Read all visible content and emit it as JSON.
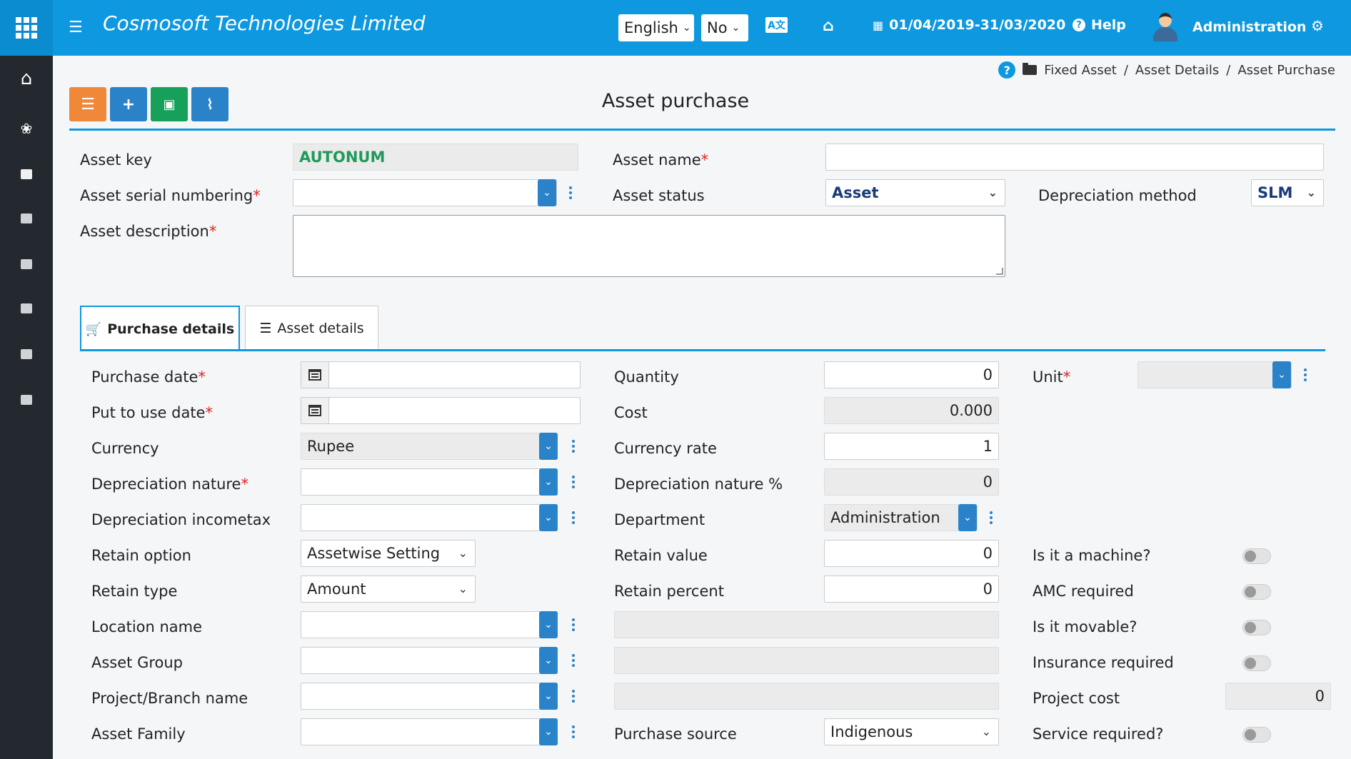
{
  "header": {
    "company": "Cosmosoft Technologies Limited",
    "language": "English",
    "no_select": "No",
    "translate_icon": "translate-icon",
    "period": "01/04/2019-31/03/2020",
    "help": "Help",
    "user": "Administration"
  },
  "breadcrumb": {
    "items": [
      "Fixed Asset",
      "Asset Details",
      "Asset Purchase"
    ]
  },
  "page": {
    "title": "Asset purchase"
  },
  "form": {
    "asset_key_label": "Asset key",
    "asset_key_value": "AUTONUM",
    "asset_name_label": "Asset name",
    "asset_serial_label": "Asset serial numbering",
    "asset_status_label": "Asset status",
    "asset_status_value": "Asset",
    "dep_method_label": "Depreciation method",
    "dep_method_value": "SLM",
    "asset_desc_label": "Asset description"
  },
  "tabs": {
    "purchase": "Purchase details",
    "asset": "Asset details"
  },
  "purchase": {
    "purchase_date": "Purchase date",
    "put_to_use_date": "Put to use date",
    "currency": "Currency",
    "currency_value": "Rupee",
    "dep_nature": "Depreciation nature",
    "dep_incometax": "Depreciation incometax",
    "retain_option": "Retain option",
    "retain_option_value": "Assetwise Setting",
    "retain_type": "Retain type",
    "retain_type_value": "Amount",
    "location": "Location name",
    "asset_group": "Asset Group",
    "project": "Project/Branch name",
    "asset_family": "Asset Family",
    "quantity": "Quantity",
    "quantity_value": "0",
    "cost": "Cost",
    "cost_value": "0.000",
    "currency_rate": "Currency rate",
    "currency_rate_value": "1",
    "dep_nature_pct": "Depreciation nature %",
    "dep_nature_pct_value": "0",
    "department": "Department",
    "department_value": "Administration",
    "retain_value": "Retain value",
    "retain_value_value": "0",
    "retain_percent": "Retain percent",
    "retain_percent_value": "0",
    "purchase_source": "Purchase source",
    "purchase_source_value": "Indigenous",
    "unit": "Unit",
    "is_machine": "Is it a machine?",
    "amc_required": "AMC required",
    "is_movable": "Is it movable?",
    "insurance_required": "Insurance required",
    "project_cost": "Project cost",
    "project_cost_value": "0",
    "service_required": "Service required?"
  }
}
